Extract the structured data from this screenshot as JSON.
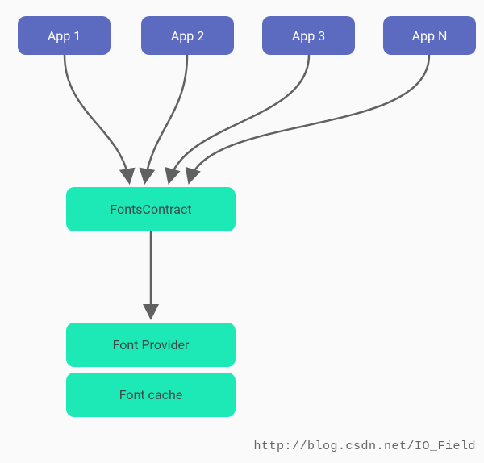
{
  "apps": {
    "app1": "App 1",
    "app2": "App 2",
    "app3": "App 3",
    "appn": "App N"
  },
  "nodes": {
    "contract": "FontsContract",
    "provider": "Font Provider",
    "cache": "Font cache"
  },
  "colors": {
    "appBox": "#5c6bc0",
    "greenBox": "#1de9b6",
    "arrow": "#616161"
  },
  "watermark": "http://blog.csdn.net/IO_Field"
}
